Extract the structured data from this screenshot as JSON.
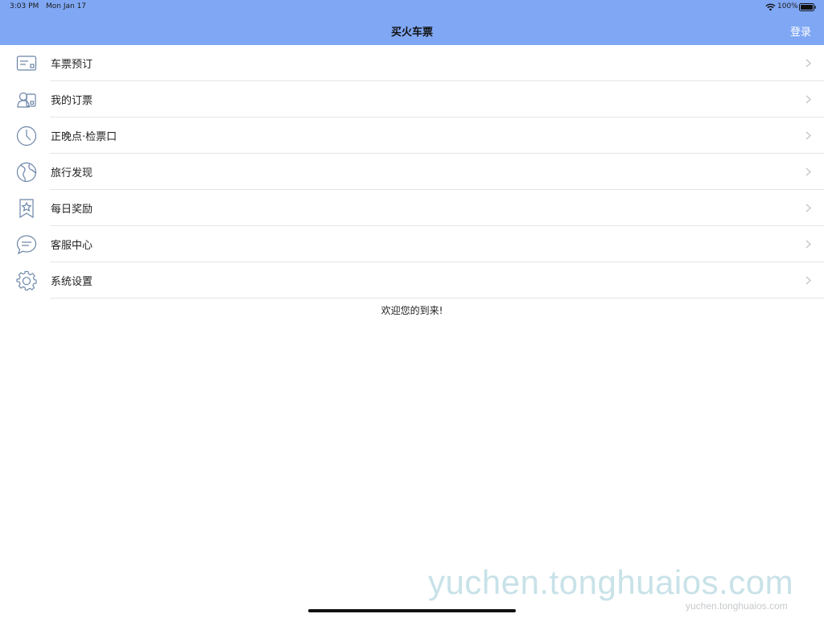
{
  "status_bar": {
    "time": "3:03 PM",
    "date": "Mon Jan 17",
    "battery": "100%"
  },
  "nav": {
    "title": "买火车票",
    "login_label": "登录"
  },
  "menu": [
    {
      "label": "车票预订",
      "icon": "ticket-icon"
    },
    {
      "label": "我的订票",
      "icon": "user-card-icon"
    },
    {
      "label": "正晚点·检票口",
      "icon": "clock-icon"
    },
    {
      "label": "旅行发现",
      "icon": "globe-icon"
    },
    {
      "label": "每日奖励",
      "icon": "star-bookmark-icon"
    },
    {
      "label": "客服中心",
      "icon": "chat-bubble-icon"
    },
    {
      "label": "系统设置",
      "icon": "gear-icon"
    }
  ],
  "welcome_text": "欢迎您的到来!",
  "watermark": {
    "large": "yuchen.tonghuaios.com",
    "small": "yuchen.tonghuaios.com"
  },
  "colors": {
    "header_bg": "#7fa7f4",
    "icon_stroke": "#6b85a8",
    "chevron": "#c7c7cc"
  }
}
